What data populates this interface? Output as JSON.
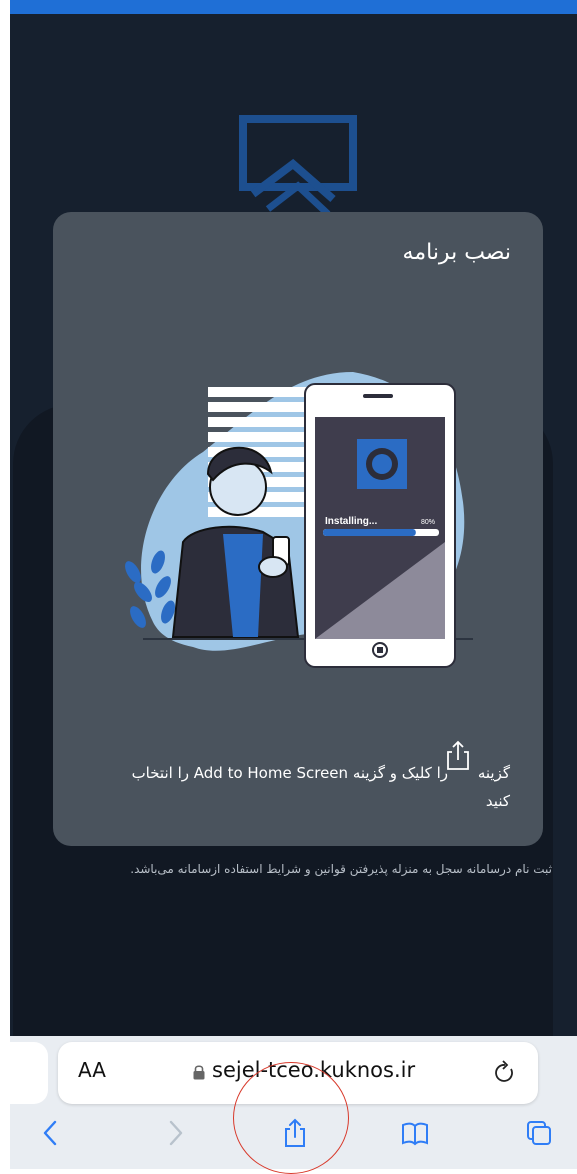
{
  "modal": {
    "title": "نصب برنامه",
    "phone_status": "Installing...",
    "phone_percent": "80%",
    "install_progress": 0.8,
    "instruction_prefix": "گزینه",
    "instruction_main": "را کلیک و گزینه Add to Home Screen را انتخاب",
    "instruction_suffix": "کنید"
  },
  "page": {
    "terms_text": "ثبت نام درسامانه سجل به منزله پذیرفتن قوانین و شرایط استفاده ازسامانه می‌باشد."
  },
  "browser": {
    "aa_label": "AA",
    "url": "sejel-tceo.kuknos.ir"
  },
  "icons": {
    "share": "share-icon",
    "back": "chevron-left-icon",
    "forward": "chevron-right-icon",
    "bookmarks": "book-icon",
    "tabs": "tabs-icon",
    "lock": "lock-icon",
    "reload": "reload-icon"
  },
  "colors": {
    "accent": "#1f6fd6",
    "modal_bg": "#4a535d",
    "annotation": "#d83a2c"
  }
}
